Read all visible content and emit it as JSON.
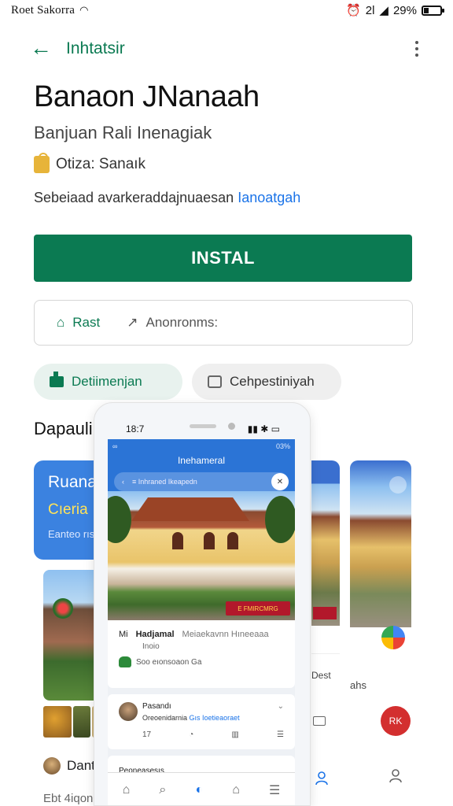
{
  "status_bar": {
    "carrier": "Roet Sakorra",
    "right_text": "2Ɩ",
    "battery": "29%",
    "battery_level": 0.29
  },
  "app_bar": {
    "title": "Inhtatsir"
  },
  "app": {
    "title": "Banaon JNanaah",
    "subtitle": "Banjuan Rali Inenagiak",
    "developer": "Otiza: Sanaık",
    "description_prefix": "Sebeiaad avarkeraddajnuaesan ",
    "description_link": "Ianoatgah"
  },
  "install_button": {
    "label": "INSTAL"
  },
  "info": {
    "item1": "Rast",
    "item2": "Anonronms:"
  },
  "chips": {
    "chip1": "Detiimenjan",
    "chip2": "Cehpestiniyah"
  },
  "section": {
    "title": "Dapaulin"
  },
  "left_cards": {
    "blue_title": "Ruana",
    "blue_sub": "Cıeria",
    "blue_small": "Eanteo rısıra",
    "row_name": "Dant",
    "footer": "Ebt 4iqon"
  },
  "mid_card": {
    "text": "Dest"
  },
  "right_card": {
    "text": "ahs",
    "button": "RK"
  },
  "phone": {
    "time": "18:7",
    "screen_status_left": "∞",
    "screen_status_right": "03%",
    "screen_title": "Inehameral",
    "search_text": "≡ Inhraned Ikeapedn",
    "hero_tag": "E FMIRCMRG",
    "card1_prefix": "Mi",
    "card1_name": "Hadjamal",
    "card1_desc": "Meiaekavnn Hıneeaaa",
    "card1_sub": "Inoio",
    "card1_meta": "Soo eıonsoaon  Ga",
    "card2_name": "Pasandı",
    "card2_sub_prefix": "Oreoenidarnia ",
    "card2_sub_link": "Gıs Ioetieaoraet",
    "card2_count": "17",
    "card3_title": "Peoneasesıs"
  },
  "icons": {
    "back": "arrow-left-icon",
    "menu": "kebab-menu-icon",
    "developer": "developer-badge-icon",
    "home": "home-icon",
    "share": "share-icon",
    "chip1": "store-icon",
    "chip2": "comment-icon"
  },
  "colors": {
    "accent_green": "#0b7a52",
    "link_blue": "#1a73e8",
    "phone_header_blue": "#2b74d6",
    "alert_red": "#b2182b"
  }
}
